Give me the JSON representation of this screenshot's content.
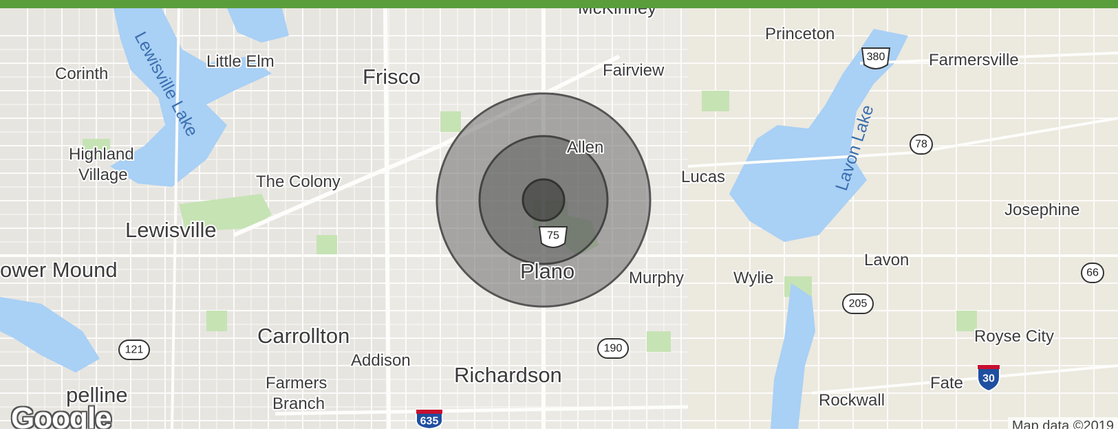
{
  "map": {
    "places": {
      "mckinney": "McKinney",
      "princeton": "Princeton",
      "farmersville": "Farmersville",
      "little_elm": "Little Elm",
      "corinth": "Corinth",
      "frisco": "Frisco",
      "fairview": "Fairview",
      "highland_village_1": "Highland",
      "highland_village_2": "Village",
      "the_colony": "The Colony",
      "allen": "Allen",
      "lucas": "Lucas",
      "josephine": "Josephine",
      "lewisville": "Lewisville",
      "flower_mound": "ower Mound",
      "plano": "Plano",
      "murphy": "Murphy",
      "wylie": "Wylie",
      "lavon": "Lavon",
      "carrollton": "Carrollton",
      "addison": "Addison",
      "richardson": "Richardson",
      "royse_city": "Royse City",
      "farmers_branch_1": "Farmers",
      "farmers_branch_2": "Branch",
      "fate": "Fate",
      "rockwall": "Rockwall",
      "coppell_partial": "pelline"
    },
    "lakes": {
      "lewisville_lake": "Lewisville Lake",
      "lavon_lake": "Lavon Lake"
    },
    "shields": {
      "us380": "380",
      "tx78": "78",
      "us75": "75",
      "tx66": "66",
      "tx205": "205",
      "tx121": "121",
      "tx190": "190",
      "i30": "30",
      "i635": "635"
    },
    "overlay_colors": {
      "outer_ring": "#6b6b6b",
      "middle_ring": "#505050",
      "inner_ring": "#333333"
    }
  },
  "branding": {
    "logo": "Google",
    "attribution": "Map data ©2019"
  }
}
